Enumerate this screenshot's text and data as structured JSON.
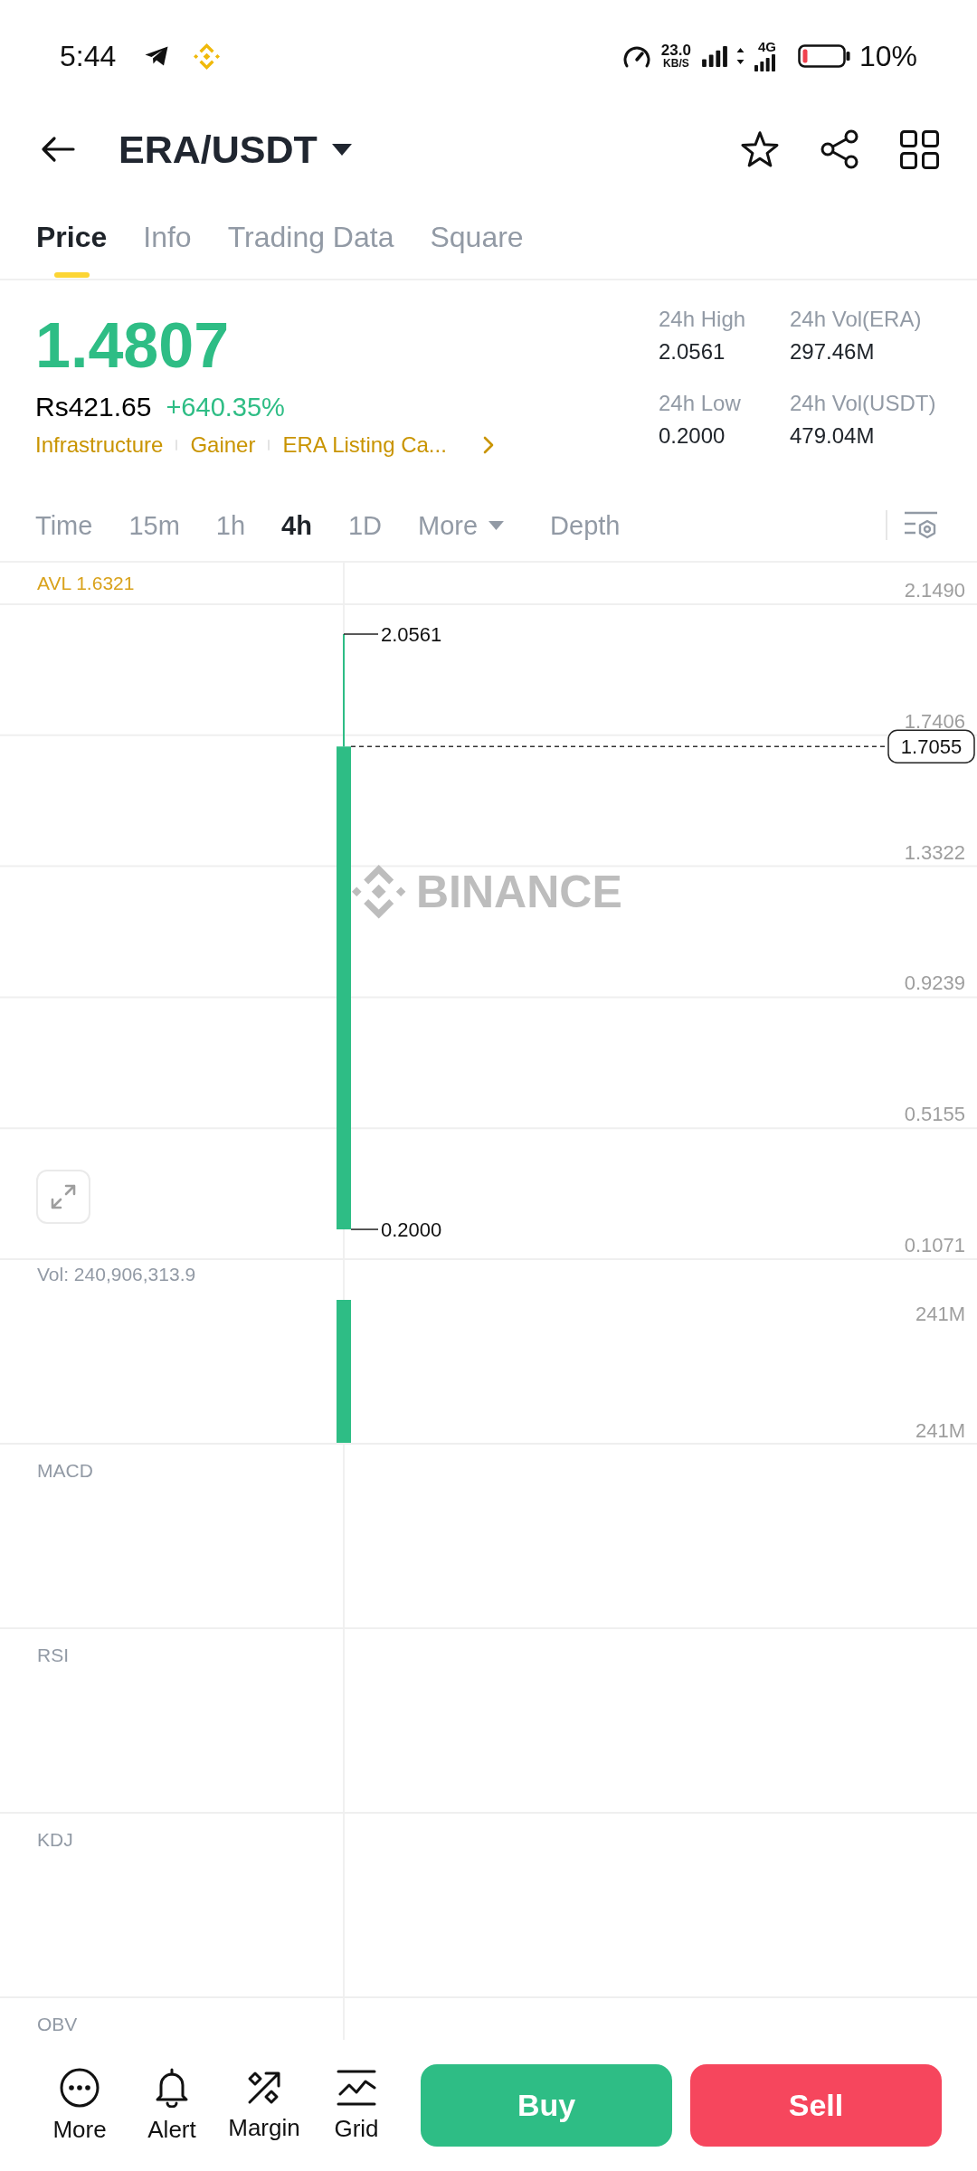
{
  "status_bar": {
    "time": "5:44",
    "net_speed": "23.0",
    "net_speed_unit": "KB/S",
    "network_type": "4G",
    "battery": "10%"
  },
  "header": {
    "pair": "ERA/USDT"
  },
  "tabs": [
    {
      "label": "Price",
      "selected": true
    },
    {
      "label": "Info",
      "selected": false
    },
    {
      "label": "Trading Data",
      "selected": false
    },
    {
      "label": "Square",
      "selected": false
    }
  ],
  "ticker": {
    "last_price": "1.4807",
    "fiat_price": "Rs421.65",
    "change": "+640.35%",
    "tags": [
      "Infrastructure",
      "Gainer",
      "ERA Listing Ca..."
    ],
    "stats": [
      {
        "label": "24h High",
        "value": "2.0561"
      },
      {
        "label": "24h Vol(ERA)",
        "value": "297.46M"
      },
      {
        "label": "24h Low",
        "value": "0.2000"
      },
      {
        "label": "24h Vol(USDT)",
        "value": "479.04M"
      }
    ]
  },
  "intervals": [
    {
      "label": "Time",
      "kind": "tab",
      "selected": false
    },
    {
      "label": "15m",
      "kind": "tab",
      "selected": false
    },
    {
      "label": "1h",
      "kind": "tab",
      "selected": false
    },
    {
      "label": "4h",
      "kind": "tab",
      "selected": true
    },
    {
      "label": "1D",
      "kind": "tab",
      "selected": false
    },
    {
      "label": "More",
      "kind": "dropdown",
      "selected": false
    },
    {
      "label": "Depth",
      "kind": "tab",
      "selected": false
    }
  ],
  "price_chart": {
    "avl": "AVL 1.6321",
    "watermark": "BINANCE",
    "y_axis": [
      "2.1490",
      "1.7406",
      "1.3322",
      "0.9239",
      "0.5155",
      "0.1071"
    ],
    "high": "2.0561",
    "low": "0.2000",
    "last_price": "1.7055"
  },
  "volume_chart": {
    "label": "Vol: 240,906,313.9",
    "y_axis": [
      "241M",
      "241M"
    ]
  },
  "indicators": [
    "MACD",
    "RSI",
    "KDJ",
    "OBV"
  ],
  "actions": [
    {
      "label": "More",
      "kind": "more"
    },
    {
      "label": "Alert",
      "kind": "alert"
    },
    {
      "label": "Margin",
      "kind": "margin"
    },
    {
      "label": "Grid",
      "kind": "grid"
    }
  ],
  "trade_buttons": [
    {
      "label": "Buy",
      "kind": "buy"
    },
    {
      "label": "Sell",
      "kind": "sell"
    }
  ]
}
